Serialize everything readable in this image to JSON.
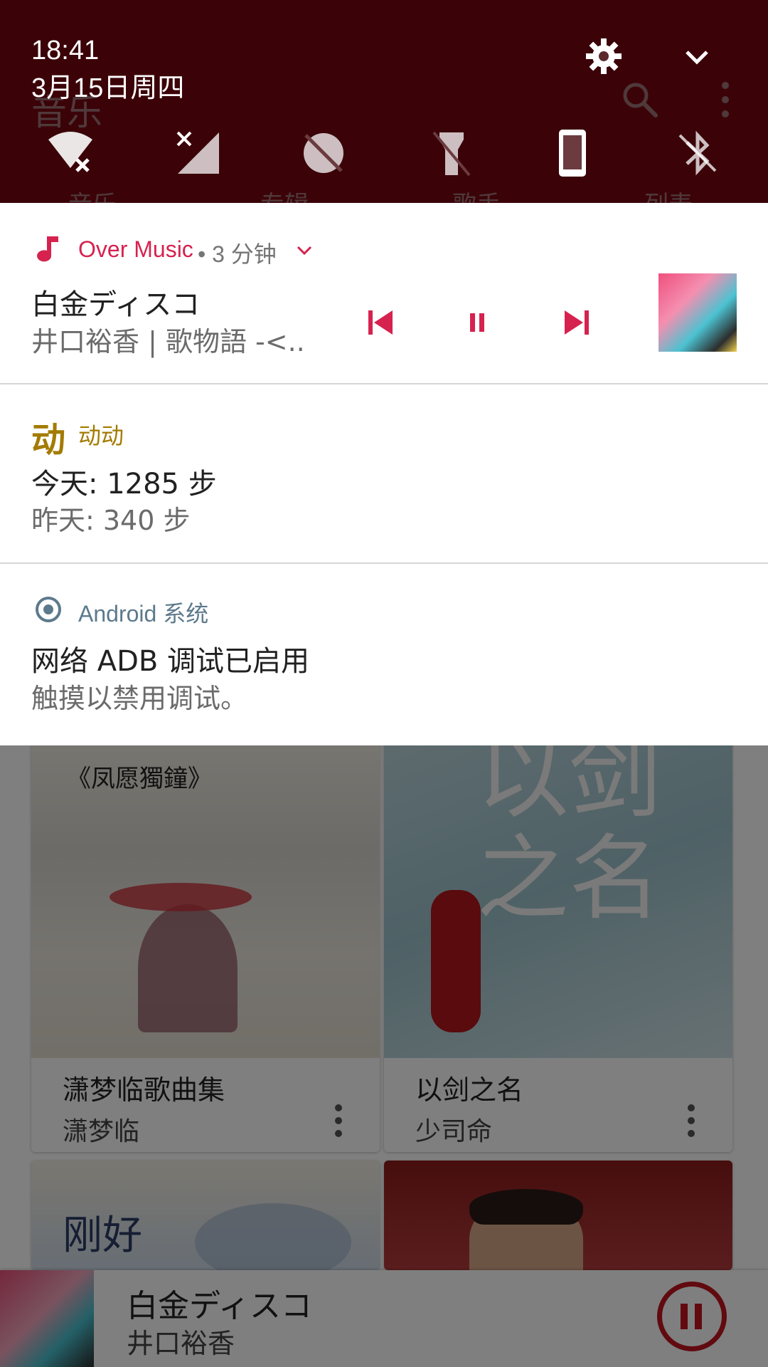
{
  "app": {
    "title": "音乐",
    "tabs": [
      "音乐",
      "专辑",
      "歌手",
      "列表"
    ],
    "albums": [
      {
        "title": "潇梦临歌曲集",
        "artist": "潇梦临",
        "art_text": "《凤愿獨鐘》"
      },
      {
        "title": "以剑之名",
        "artist": "少司命",
        "art_text": "以剑之名"
      },
      {
        "title": "",
        "artist": "",
        "art_text": "刚好"
      },
      {
        "title": "",
        "artist": "",
        "art_text": ""
      }
    ],
    "mini_player": {
      "title": "白金ディスコ",
      "artist": "井口裕香"
    }
  },
  "status": {
    "time": "18:41",
    "date": "3月15日周四"
  },
  "quick_settings": {
    "tiles": [
      "wifi-off-icon",
      "signal-off-icon",
      "do-not-disturb-off-icon",
      "flashlight-off-icon",
      "auto-rotate-portrait-icon",
      "bluetooth-off-icon"
    ]
  },
  "notifications": {
    "media": {
      "app": "Over Music",
      "meta": " • 3 分钟",
      "title": "白金ディスコ",
      "text": "井口裕香 | 歌物語 -<..",
      "accent": "#d6224f"
    },
    "steps": {
      "app": "动动",
      "title": "今天: 1285 步",
      "text": "昨天: 340 步",
      "accent": "#a37b00"
    },
    "system": {
      "app": "Android 系统",
      "title": "网络 ADB 调试已启用",
      "text": "触摸以禁用调试。",
      "accent": "#5c7a8c"
    }
  }
}
